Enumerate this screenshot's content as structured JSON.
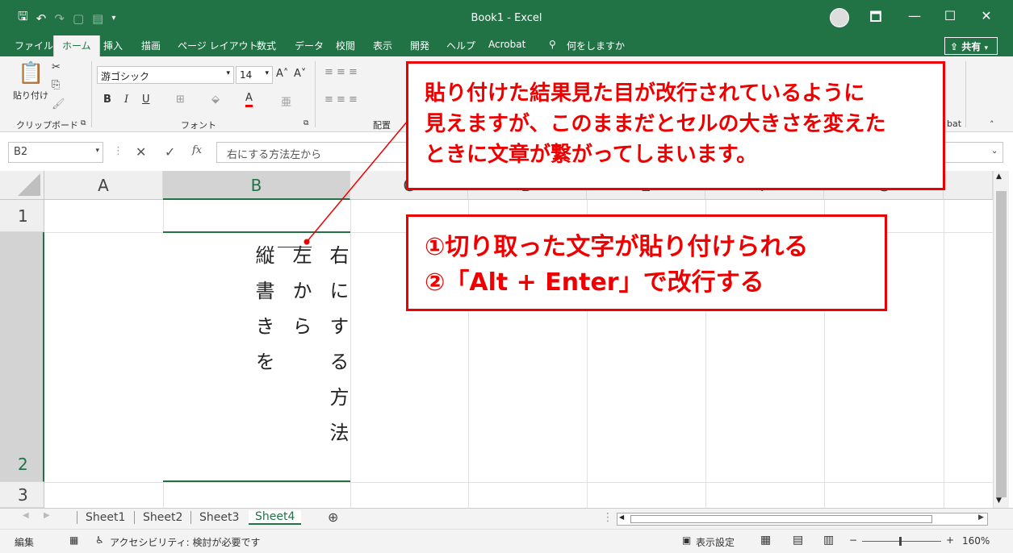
{
  "window": {
    "title": "Book1  -  Excel",
    "controls": [
      "🗖",
      "—",
      "☐",
      "✕"
    ]
  },
  "qat": {
    "save_icon": "save-icon",
    "undo_icon": "undo-icon",
    "redo_icon": "redo-icon"
  },
  "tabs": [
    {
      "label": "ファイル"
    },
    {
      "label": "ホーム"
    },
    {
      "label": "挿入"
    },
    {
      "label": "描画"
    },
    {
      "label": "ページ レイアウト"
    },
    {
      "label": "数式"
    },
    {
      "label": "データ"
    },
    {
      "label": "校閲"
    },
    {
      "label": "表示"
    },
    {
      "label": "開発"
    },
    {
      "label": "ヘルプ"
    },
    {
      "label": "Acrobat"
    },
    {
      "label": "何をしますか"
    }
  ],
  "share_label": "共有",
  "ribbon": {
    "paste_label": "貼り付け",
    "clipboard_label": "クリップボード",
    "font_label": "フォント",
    "font_name": "游ゴシック",
    "font_size": "14",
    "alignment_label": "配置",
    "acrobat_label": "bat",
    "bold": "B",
    "italic": "I",
    "underline": "U",
    "font_color_letter": "A"
  },
  "formula_bar": {
    "name_box": "B2",
    "fx": "fx",
    "content": "右にする方法左から"
  },
  "columns": [
    "A",
    "B",
    "C",
    "D",
    "E",
    "F",
    "G"
  ],
  "rows": [
    "1",
    "2",
    "3"
  ],
  "cell_b2": {
    "col1": "右にする方法",
    "col2": "左から",
    "col3": "縦書きを"
  },
  "sheets": [
    "Sheet1",
    "Sheet2",
    "Sheet3",
    "Sheet4"
  ],
  "active_sheet": "Sheet4",
  "status": {
    "mode": "編集",
    "accessibility": "アクセシビリティ: 検討が必要です",
    "display_settings": "表示設定",
    "zoom": "160%"
  },
  "callouts": {
    "top": [
      "貼り付けた結果見た目が改行されているように",
      "見えますが、このままだとセルの大きさを変えた",
      "ときに文章が繋がってしまいます。"
    ],
    "bottom": [
      "①切り取った文字が貼り付けられる",
      "②「Alt + Enter」で改行する"
    ]
  },
  "colors": {
    "excel_green": "#217346",
    "callout_red": "#e00000"
  }
}
